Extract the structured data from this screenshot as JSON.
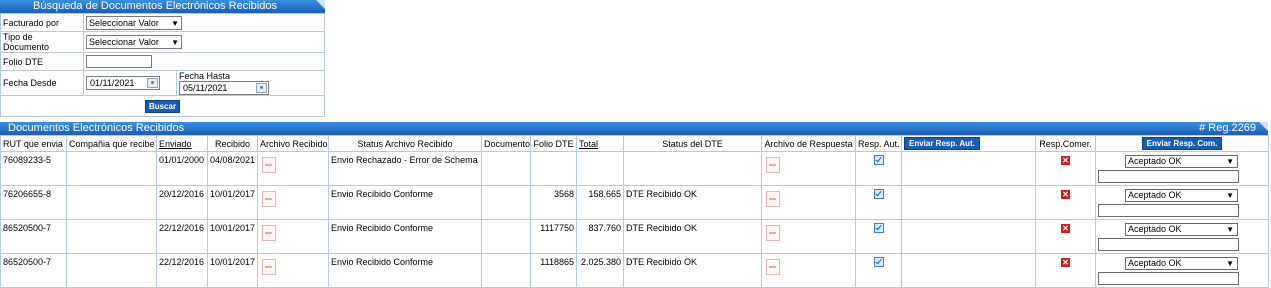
{
  "search": {
    "title": "Búsqueda de Documentos Electrónicos Recibidos",
    "facturado_label": "Facturado por",
    "facturado_value": "Seleccionar Valor",
    "tipo_label": "Tipo de Documento",
    "tipo_value": "Seleccionar Valor",
    "folio_label": "Folio DTE",
    "folio_value": "",
    "desde_label": "Fecha Desde",
    "desde_value": "01/11/2021",
    "hasta_label": "Fecha Hasta",
    "hasta_value": "05/11/2021",
    "buscar_label": "Buscar"
  },
  "results": {
    "title": "Documentos Electrónicos Recibidos",
    "reg_count": "# Reg.2269",
    "headers": {
      "rut": "RUT que envia",
      "compania": "Compañia que recibe",
      "enviado": "Enviado",
      "recibido": "Recibido",
      "archivo": "Archivo Recibido",
      "status_archivo": "Status Archivo Recibido",
      "documento": "Documento",
      "folio": "Folio DTE",
      "total": "Total",
      "status_dte": "Status del DTE",
      "archivo_resp": "Archivo de Respuesta",
      "resp_aut": "Resp. Aut.",
      "enviar_resp_aut": "Enviar Resp. Aut.",
      "resp_comer": "Resp.Comer.",
      "enviar_resp_com": "Enviar Resp. Com."
    },
    "rows": [
      {
        "rut": "76089233-5",
        "compania": "",
        "enviado": "01/01/2000",
        "recibido": "04/08/2021",
        "status_archivo": "Envio Rechazado - Error de Schema",
        "documento": "",
        "folio": "",
        "total": "",
        "status_dte": "",
        "resp_com_value": "Aceptado OK"
      },
      {
        "rut": "76206655-8",
        "compania": "",
        "enviado": "20/12/2016",
        "recibido": "10/01/2017",
        "status_archivo": "Envio Recibido Conforme",
        "documento": "",
        "folio": "3568",
        "total": "158.665",
        "status_dte": "DTE Recibido OK",
        "resp_com_value": "Aceptado OK"
      },
      {
        "rut": "86520500-7",
        "compania": "",
        "enviado": "22/12/2016",
        "recibido": "10/01/2017",
        "status_archivo": "Envio Recibido Conforme",
        "documento": "",
        "folio": "1117750",
        "total": "837.760",
        "status_dte": "DTE Recibido OK",
        "resp_com_value": "Aceptado OK"
      },
      {
        "rut": "86520500-7",
        "compania": "",
        "enviado": "22/12/2016",
        "recibido": "10/01/2017",
        "status_archivo": "Envio Recibido Conforme",
        "documento": "",
        "folio": "1118865",
        "total": "2.025.380",
        "status_dte": "DTE Recibido OK",
        "resp_com_value": "Aceptado OK"
      }
    ]
  },
  "icons": {
    "file": "document-icon",
    "check": "checkbox-checked-icon",
    "reject": "red-x-icon",
    "calendar": "calendar-icon"
  },
  "colors": {
    "header_blue": "#1a5eb4",
    "border": "#b5c9e3",
    "reject_red": "#d11c1c"
  }
}
